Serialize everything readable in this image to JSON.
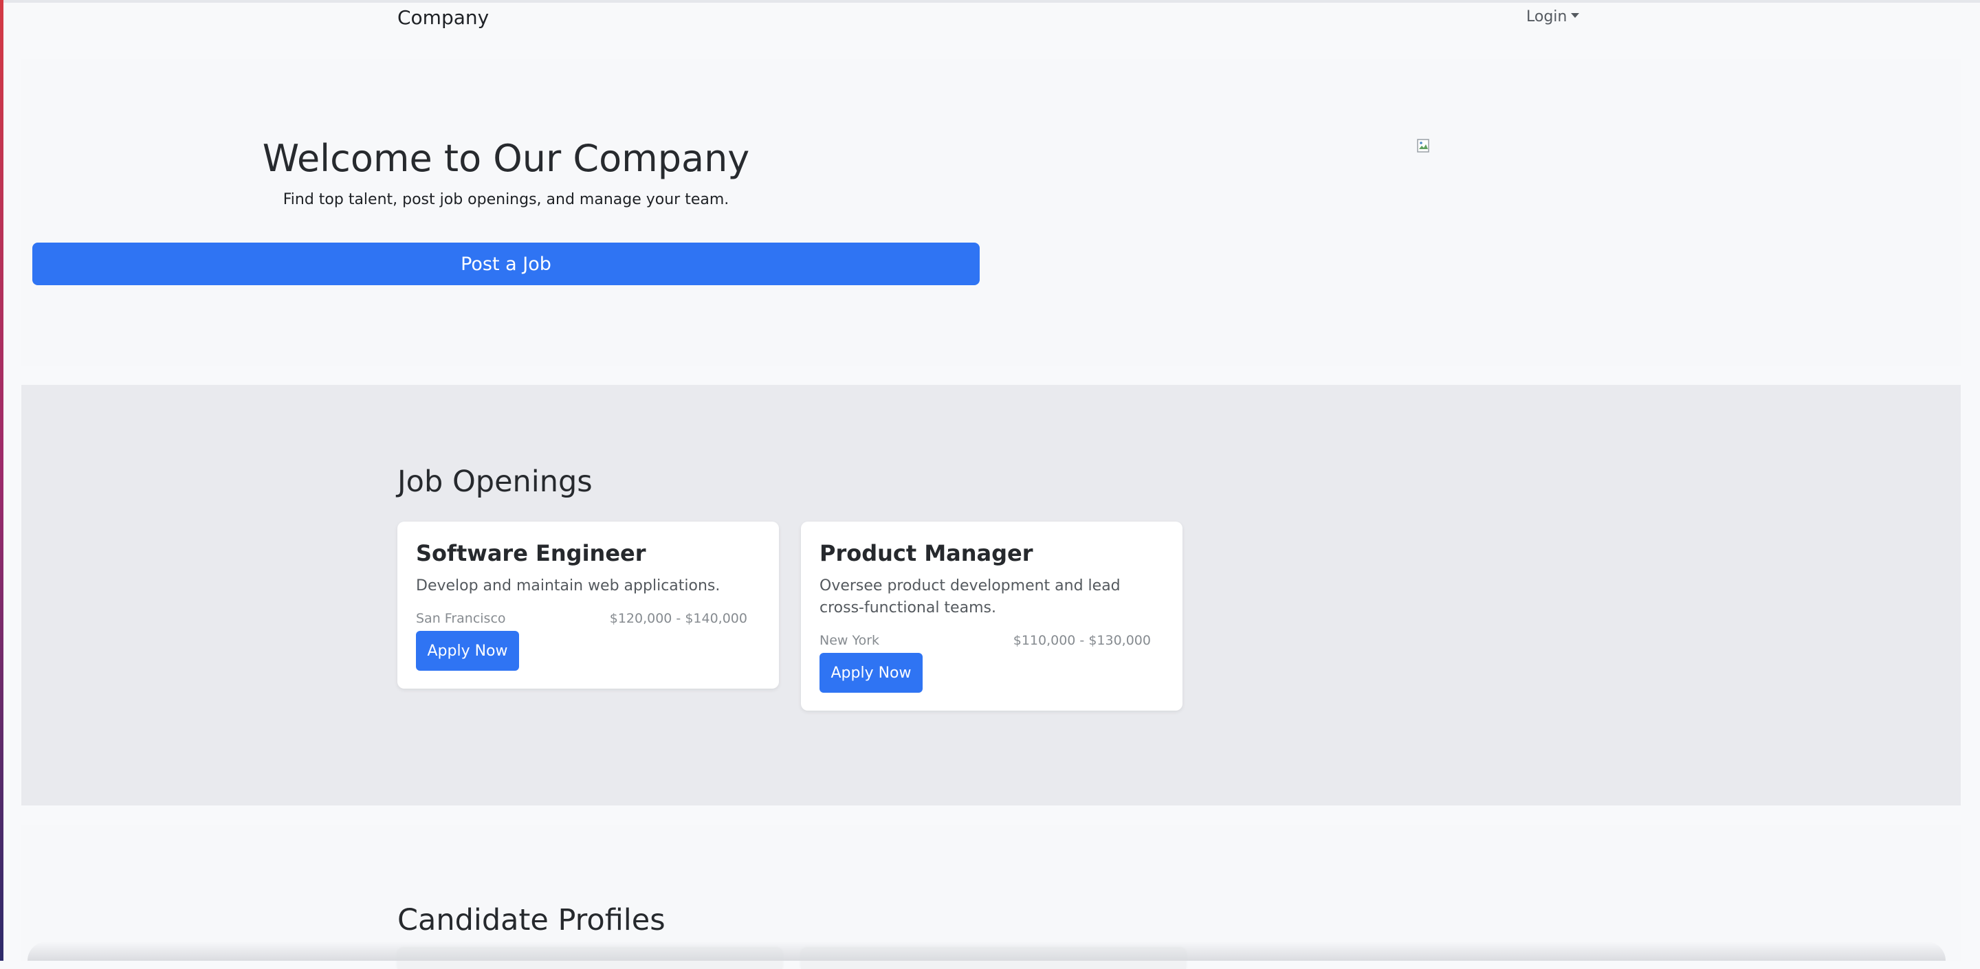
{
  "navbar": {
    "brand": "Company",
    "login_label": "Login"
  },
  "hero": {
    "title": "Welcome to Our Company",
    "subtitle": "Find top talent, post job openings, and manage your team.",
    "cta_label": "Post a Job"
  },
  "jobs": {
    "heading": "Job Openings",
    "items": [
      {
        "title": "Software Engineer",
        "description": "Develop and maintain web applications.",
        "location": "San Francisco",
        "salary": "$120,000 - $140,000",
        "apply_label": "Apply Now"
      },
      {
        "title": "Product Manager",
        "description": "Oversee product development and lead cross-functional teams.",
        "location": "New York",
        "salary": "$110,000 - $130,000",
        "apply_label": "Apply Now"
      }
    ]
  },
  "candidates": {
    "heading": "Candidate Profiles"
  },
  "colors": {
    "primary": "#2f74f3",
    "hero_bg": "#f7f8fa",
    "jobs_bg": "#e9eaee"
  },
  "icons": {
    "hero_image": "broken-image-icon",
    "login_caret": "caret-down-icon"
  }
}
